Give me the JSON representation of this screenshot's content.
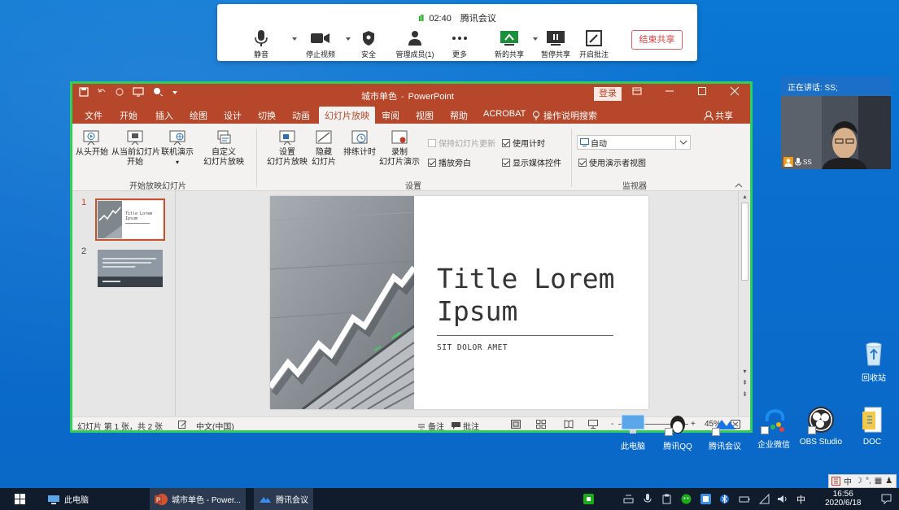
{
  "meeting": {
    "timer": "02:40",
    "app_name": "腾讯会议",
    "buttons": {
      "mute": "静音",
      "stop_video": "停止视频",
      "security": "安全",
      "members": "管理成员(1)",
      "more": "更多",
      "new_share": "新的共享",
      "pause_share": "暂停共享",
      "annotate": "开启批注"
    },
    "end_share": "结束共享"
  },
  "ppt": {
    "filename": "城市单色",
    "app": "PowerPoint",
    "title_sep": "-",
    "login": "登录",
    "tabs": [
      "文件",
      "开始",
      "插入",
      "绘图",
      "设计",
      "切换",
      "动画",
      "幻灯片放映",
      "审阅",
      "视图",
      "帮助",
      "ACROBAT",
      "操作说明搜索"
    ],
    "share": "共享",
    "ribbon": {
      "from_start": "从头开始",
      "from_current_1": "从当前幻灯片",
      "from_current_2": "开始",
      "online_1": "联机演示",
      "custom_1": "自定义",
      "custom_2": "幻灯片放映",
      "group_start": "开始放映幻灯片",
      "setup_1": "设置",
      "setup_2": "幻灯片放映",
      "hide_1": "隐藏",
      "hide_2": "幻灯片",
      "rehearse": "排练计时",
      "record_1": "录制",
      "record_2": "幻灯片演示",
      "keep_updated": "保持幻灯片更新",
      "use_timing": "使用计时",
      "play_narration": "播放旁白",
      "show_media": "显示媒体控件",
      "group_setup": "设置",
      "monitor_value": "自动",
      "presenter_view": "使用演示者视图",
      "group_monitor": "监视器"
    },
    "slides": [
      {
        "number": "1",
        "title_preview_1": "Title Lorem",
        "title_preview_2": "Ipsum"
      },
      {
        "number": "2"
      }
    ],
    "slide": {
      "title_line1": "Title Lorem",
      "title_line2": "Ipsum",
      "subtitle": "SIT DOLOR AMET"
    },
    "status": {
      "slide_info": "幻灯片 第 1 张，共 2 张",
      "language": "中文(中国)",
      "notes": "备注",
      "comments": "批注",
      "zoom_minus": "-",
      "zoom_plus": "+",
      "zoom": "45%"
    }
  },
  "video": {
    "speaking": "正在讲话: SS;",
    "participant": "SS"
  },
  "desktop_icons": {
    "recycle": "回收站",
    "this_pc": "此电脑",
    "qq": "腾讯QQ",
    "meeting": "腾讯会议",
    "wecom": "企业微信",
    "obs": "OBS Studio",
    "doc": "DOC"
  },
  "taskbar": {
    "this_pc": "此电脑",
    "ppt": "城市单色 - Power...",
    "meeting": "腾讯会议",
    "ime_lang": "中",
    "time": "16:56",
    "date": "2020/6/18",
    "tray_lang": "中"
  },
  "colors": {
    "ppt_accent": "#b7472a",
    "share_border": "#2fd05a",
    "desktop_blue": "#0a6fcf",
    "end_share_red": "#e23d3d"
  }
}
